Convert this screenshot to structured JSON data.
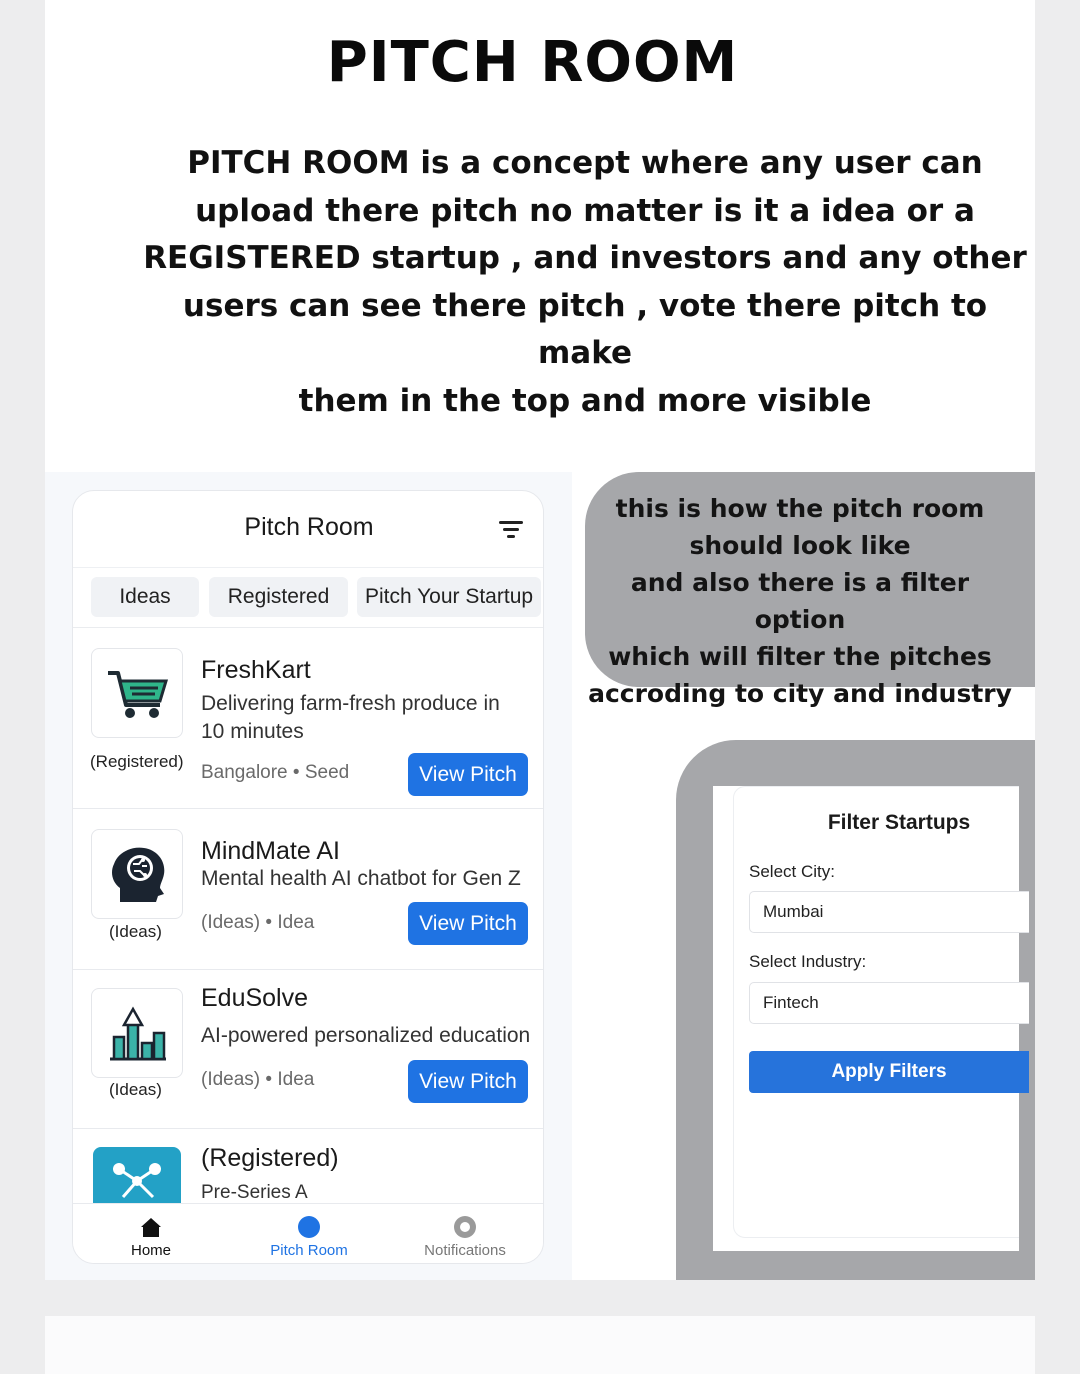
{
  "poster": {
    "title": "PITCH ROOM",
    "intro_lines": [
      "PITCH ROOM is a concept where any user can",
      "upload there pitch no matter is it a idea or a",
      "REGISTERED startup , and investors and any other",
      "users can see there pitch , vote there pitch to make",
      "them in the top and more visible"
    ],
    "callout_lines": [
      "this is how the pitch room",
      "should look like",
      "and also there is a filter option",
      "which will filter the pitches",
      "accroding to city and industry"
    ]
  },
  "app": {
    "title": "Pitch Room",
    "filter_icon": "filter-icon",
    "tabs": [
      "Ideas",
      "Registered",
      "Pitch Your Startup"
    ],
    "cards": [
      {
        "name": "FreshKart",
        "desc_lines": [
          "Delivering farm-fresh produce in",
          "10 minutes"
        ],
        "tag": "(Registered)",
        "meta": "Bangalore • Seed",
        "button": "View Pitch",
        "icon": "shopping-cart-icon"
      },
      {
        "name": "MindMate AI",
        "desc_lines": [
          "Mental health AI chatbot for Gen Z"
        ],
        "tag": "(Ideas)",
        "meta": "(Ideas) • Idea",
        "button": "View Pitch",
        "icon": "ai-brain-head-icon"
      },
      {
        "name": "EduSolve",
        "desc_lines": [
          "AI-powered personalized education"
        ],
        "tag": "(Ideas)",
        "meta": "(Ideas) • Idea",
        "button": "View Pitch",
        "icon": "growth-chart-icon"
      },
      {
        "name": "(Registered)",
        "desc_lines": [
          "Pre-Series A"
        ],
        "icon": "network-nodes-icon"
      }
    ],
    "nav": [
      {
        "label": "Home",
        "icon": "home-icon",
        "color": "#111111"
      },
      {
        "label": "Pitch Room",
        "icon": "pitch-room-dot-icon",
        "color": "#1f73e3"
      },
      {
        "label": "Notifications",
        "icon": "notification-circle-icon",
        "color": "#777777"
      }
    ]
  },
  "filter": {
    "title": "Filter Startups",
    "city_label": "Select City:",
    "city_value": "Mumbai",
    "industry_label": "Select Industry:",
    "industry_value": "Fintech",
    "apply_label": "Apply Filters"
  },
  "colors": {
    "accent": "#1f73e3",
    "callout_gray": "#a6a7aa"
  }
}
